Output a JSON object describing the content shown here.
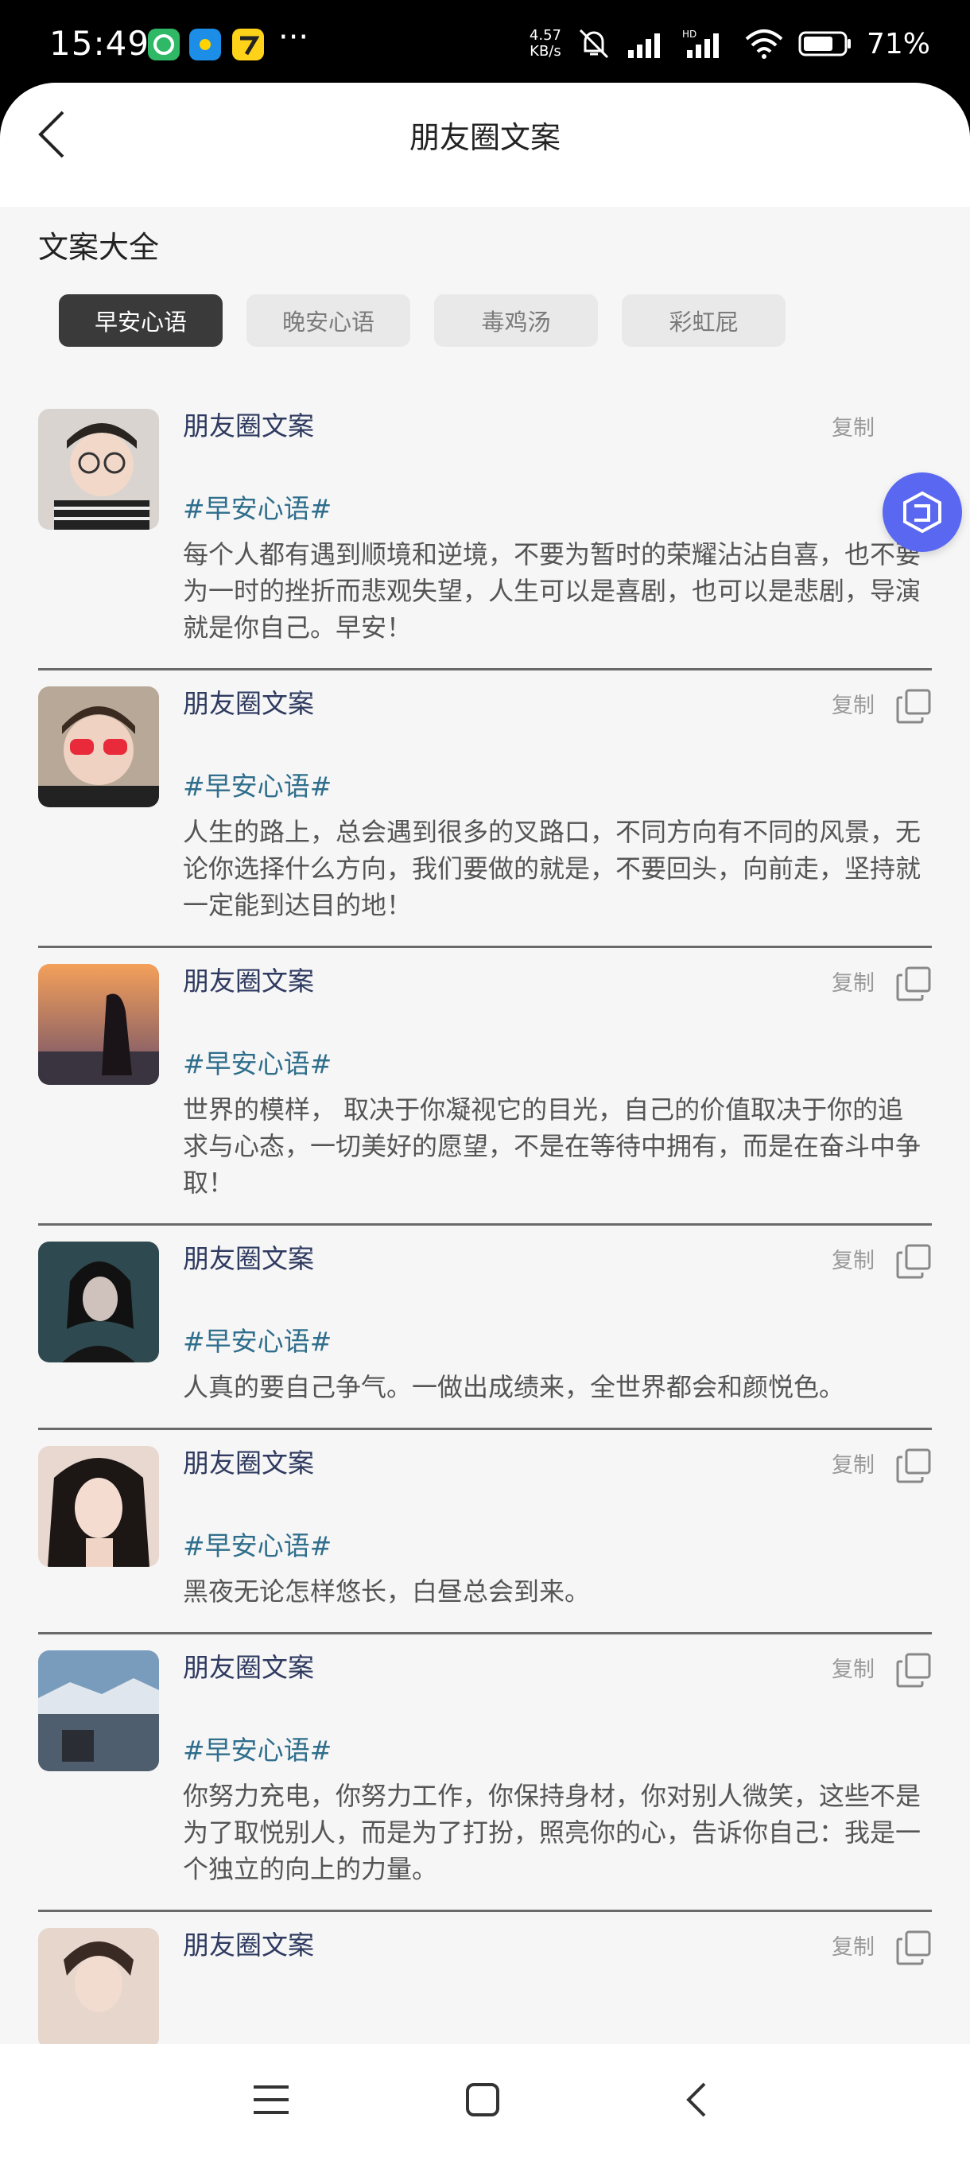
{
  "status_bar": {
    "time": "15:49",
    "speed_value": "4.57",
    "speed_unit": "KB/s",
    "battery": "71%"
  },
  "header": {
    "title": "朋友圈文案"
  },
  "section": {
    "title": "文案大全"
  },
  "tabs": [
    {
      "label": "早安心语",
      "active": true
    },
    {
      "label": "晚安心语",
      "active": false
    },
    {
      "label": "毒鸡汤",
      "active": false
    },
    {
      "label": "彩虹屁",
      "active": false
    }
  ],
  "items": [
    {
      "name": "朋友圈文案",
      "tag": "#早安心语#",
      "copy_label": "复制",
      "text": "每个人都有遇到顺境和逆境，不要为暂时的荣耀沾沾自喜，也不要为一时的挫折而悲观失望，人生可以是喜剧，也可以是悲剧，导演就是你自己。早安！"
    },
    {
      "name": "朋友圈文案",
      "tag": "#早安心语#",
      "copy_label": "复制",
      "text": "人生的路上，总会遇到很多的叉路口，不同方向有不同的风景，无论你选择什么方向，我们要做的就是，不要回头，向前走，坚持就一定能到达目的地！"
    },
    {
      "name": "朋友圈文案",
      "tag": "#早安心语#",
      "copy_label": "复制",
      "text": "世界的模样， 取决于你凝视它的目光，自己的价值取决于你的追求与心态，一切美好的愿望，不是在等待中拥有，而是在奋斗中争取！"
    },
    {
      "name": "朋友圈文案",
      "tag": "#早安心语#",
      "copy_label": "复制",
      "text": "人真的要自己争气。一做出成绩来，全世界都会和颜悦色。"
    },
    {
      "name": "朋友圈文案",
      "tag": "#早安心语#",
      "copy_label": "复制",
      "text": "黑夜无论怎样悠长，白昼总会到来。"
    },
    {
      "name": "朋友圈文案",
      "tag": "#早安心语#",
      "copy_label": "复制",
      "text": "你努力充电，你努力工作，你保持身材，你对别人微笑，这些不是为了取悦别人，而是为了打扮，照亮你的心，告诉你自己：我是一个独立的向上的力量。"
    },
    {
      "name": "朋友圈文案",
      "tag": "",
      "copy_label": "复制",
      "text": ""
    }
  ]
}
